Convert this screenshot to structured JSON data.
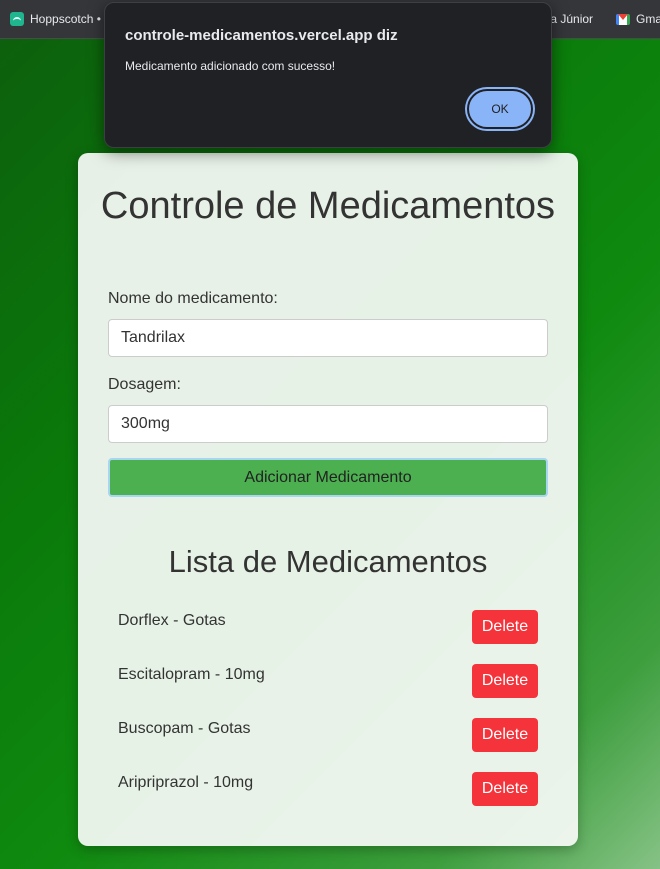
{
  "bookmarks": {
    "hoppscotch": "Hoppscotch •",
    "junior": "eia Júnior",
    "gmail": "Gma"
  },
  "dialog": {
    "title": "controle-medicamentos.vercel.app diz",
    "message": "Medicamento adicionado com sucesso!",
    "ok_label": "OK"
  },
  "form": {
    "title": "Controle de Medicamentos",
    "name_label": "Nome do medicamento:",
    "name_value": "Tandrilax",
    "dose_label": "Dosagem:",
    "dose_value": "300mg",
    "add_label": "Adicionar Medicamento"
  },
  "list": {
    "title": "Lista de Medicamentos",
    "delete_label": "Delete",
    "items": [
      {
        "text": "Dorflex - Gotas"
      },
      {
        "text": "Escitalopram - 10mg"
      },
      {
        "text": "Buscopam - Gotas"
      },
      {
        "text": "Aripriprazol - 10mg"
      }
    ]
  },
  "colors": {
    "add_button": "#4caf50",
    "delete_button": "#f4333a",
    "dialog_ok": "#8ab4f8"
  }
}
